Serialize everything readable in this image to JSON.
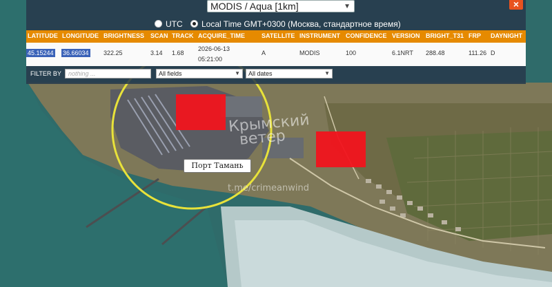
{
  "satellite_select": {
    "value": "MODIS / Aqua [1km]"
  },
  "close_label": "×",
  "timezone": {
    "utc_label": "UTC",
    "local_label": "Local Time GMT+0300 (Москва, стандартное время)",
    "selected": "local"
  },
  "table": {
    "headers": [
      "LATITUDE",
      "LONGITUDE",
      "BRIGHTNESS",
      "SCAN",
      "TRACK",
      "ACQUIRE_TIME",
      "SATELLITE",
      "INSTRUMENT",
      "CONFIDENCE",
      "VERSION",
      "BRIGHT_T31",
      "FRP",
      "DAYNIGHT"
    ],
    "row": {
      "latitude": "45.15244",
      "longitude": "36.66034",
      "brightness": "322.25",
      "scan": "3.14",
      "track": "1.68",
      "acquire_date": "2026-06-13",
      "acquire_time": "05:21:00",
      "satellite": "A",
      "instrument": "MODIS",
      "confidence": "100",
      "version": "6.1NRT",
      "bright_t31": "288.48",
      "frp": "111.26",
      "daynight": "D"
    }
  },
  "filter": {
    "label": "FILTER BY",
    "placeholder": "nothing ...",
    "fields_value": "All fields",
    "dates_value": "All dates"
  },
  "map": {
    "place_label": "Порт Тамань",
    "watermark_line1": "Крымский",
    "watermark_line2": "ветер",
    "watermark_url": "t.me/crimeanwind",
    "fire_color": "#f1141e",
    "circle_color": "#e8e23a"
  }
}
